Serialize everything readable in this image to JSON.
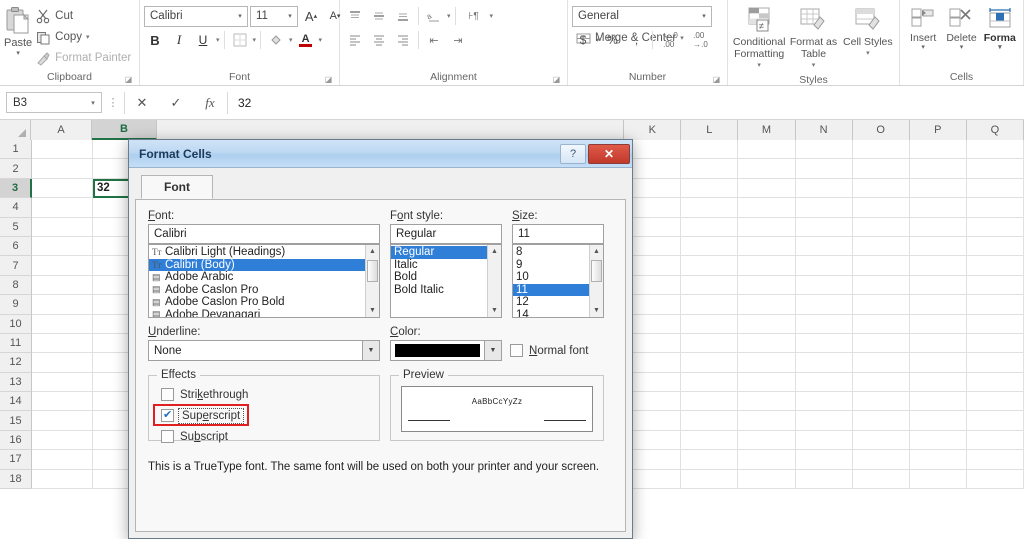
{
  "ribbon": {
    "groups": [
      {
        "name": "Clipboard",
        "label": "Clipboard"
      },
      {
        "name": "Font",
        "label": "Font"
      },
      {
        "name": "Alignment",
        "label": "Alignment"
      },
      {
        "name": "Number",
        "label": "Number"
      },
      {
        "name": "Styles",
        "label": "Styles"
      },
      {
        "name": "Cells",
        "label": "Cells"
      }
    ],
    "clipboard": {
      "paste": "Paste",
      "cut": "Cut",
      "copy": "Copy",
      "format_painter": "Format Painter"
    },
    "font": {
      "font_name": "Calibri",
      "font_size": "11",
      "bold": "B",
      "italic": "I",
      "underline": "U",
      "grow_font": "A",
      "shrink_font": "A"
    },
    "alignment": {
      "wrap_text": "Wrap Text",
      "merge_center": "Merge & Center"
    },
    "number": {
      "format": "General",
      "currency": "$",
      "percent": "%",
      "comma": ","
    },
    "styles": {
      "conditional_formatting": "Conditional Formatting",
      "format_as_table": "Format as Table",
      "cell_styles": "Cell Styles"
    },
    "cells": {
      "insert": "Insert",
      "delete": "Delete",
      "format": "Forma"
    }
  },
  "formula_bar": {
    "name_box": "B3",
    "cancel": "✕",
    "enter": "✓",
    "insert_function": "fx",
    "value": "32"
  },
  "grid": {
    "columns": [
      "A",
      "B",
      "K",
      "L",
      "M",
      "N",
      "O",
      "P",
      "Q"
    ],
    "rows": [
      "1",
      "2",
      "3",
      "4",
      "5",
      "6",
      "7",
      "8",
      "9",
      "10",
      "11",
      "12",
      "13",
      "14",
      "15",
      "16",
      "17",
      "18"
    ],
    "selected_column": "B",
    "selected_row": "3",
    "active_cell": "B3",
    "active_cell_value": "32"
  },
  "dialog": {
    "title": "Format Cells",
    "help_button": "?",
    "close_button": "✕",
    "tab": "Font",
    "font_label": "Font:",
    "font_value": "Calibri",
    "font_list": [
      "Calibri Light (Headings)",
      "Calibri (Body)",
      "Adobe Arabic",
      "Adobe Caslon Pro",
      "Adobe Caslon Pro Bold",
      "Adobe Devanagari"
    ],
    "font_selected": "Calibri (Body)",
    "style_label": "Font style:",
    "style_value": "Regular",
    "style_list": [
      "Regular",
      "Italic",
      "Bold",
      "Bold Italic"
    ],
    "style_selected": "Regular",
    "size_label": "Size:",
    "size_value": "11",
    "size_list": [
      "8",
      "9",
      "10",
      "11",
      "12",
      "14"
    ],
    "size_selected": "11",
    "underline_label": "Underline:",
    "underline_value": "None",
    "color_label": "Color:",
    "color_value": "#000000",
    "normal_font_label": "Normal font",
    "normal_font_checked": false,
    "effects_label": "Effects",
    "effects": [
      {
        "label": "Strikethrough",
        "checked": false,
        "highlighted": false
      },
      {
        "label": "Superscript",
        "checked": true,
        "highlighted": true
      },
      {
        "label": "Subscript",
        "checked": false,
        "highlighted": false
      }
    ],
    "preview_label": "Preview",
    "preview_text": "AaBbCcYyZz",
    "description": "This is a TrueType font.  The same font will be used on both your printer and your screen.",
    "highlight_color": "#e02020",
    "selection_color": "#2f7fd8"
  }
}
